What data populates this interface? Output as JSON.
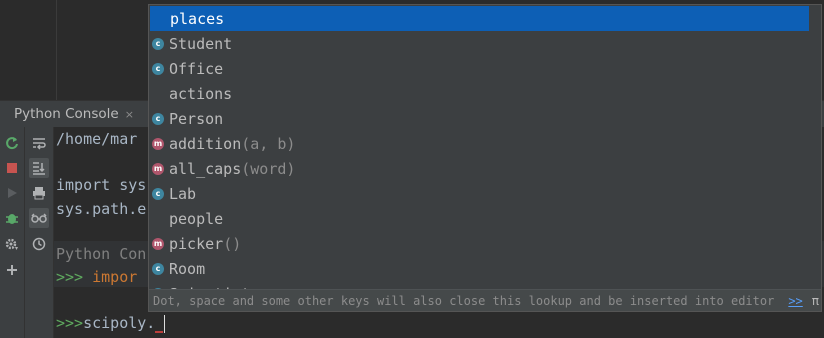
{
  "tool_window": {
    "tab_title": "Python Console",
    "tab_close": "×"
  },
  "console": {
    "lines": [
      "/home/mar",
      "",
      "import sys",
      "sys.path.e"
    ],
    "section_label": "Python Con",
    "prompt": ">>>",
    "import_partial": "impor",
    "current_input": "scipoly."
  },
  "completion": {
    "items": [
      {
        "name": "places",
        "kind": "",
        "sig": ""
      },
      {
        "name": "Student",
        "kind": "c",
        "sig": ""
      },
      {
        "name": "Office",
        "kind": "c",
        "sig": ""
      },
      {
        "name": "actions",
        "kind": "",
        "sig": ""
      },
      {
        "name": "Person",
        "kind": "c",
        "sig": ""
      },
      {
        "name": "addition",
        "kind": "m",
        "sig": "(a, b)"
      },
      {
        "name": "all_caps",
        "kind": "m",
        "sig": "(word)"
      },
      {
        "name": "Lab",
        "kind": "c",
        "sig": ""
      },
      {
        "name": "people",
        "kind": "",
        "sig": ""
      },
      {
        "name": "picker",
        "kind": "m",
        "sig": "()"
      },
      {
        "name": "Room",
        "kind": "c",
        "sig": ""
      },
      {
        "name": "Scientist",
        "kind": "c",
        "sig": ""
      }
    ],
    "selected_index": 0,
    "footer_hint": "Dot, space and some other keys will also close this lookup and be inserted into editor",
    "footer_link": ">>",
    "footer_pi": "π"
  },
  "colors": {
    "selection": "#0d5fb5",
    "class_badge": "#3e86a0",
    "method_badge": "#b0566c",
    "prompt": "#5faa5f",
    "keyword": "#cc7832"
  }
}
